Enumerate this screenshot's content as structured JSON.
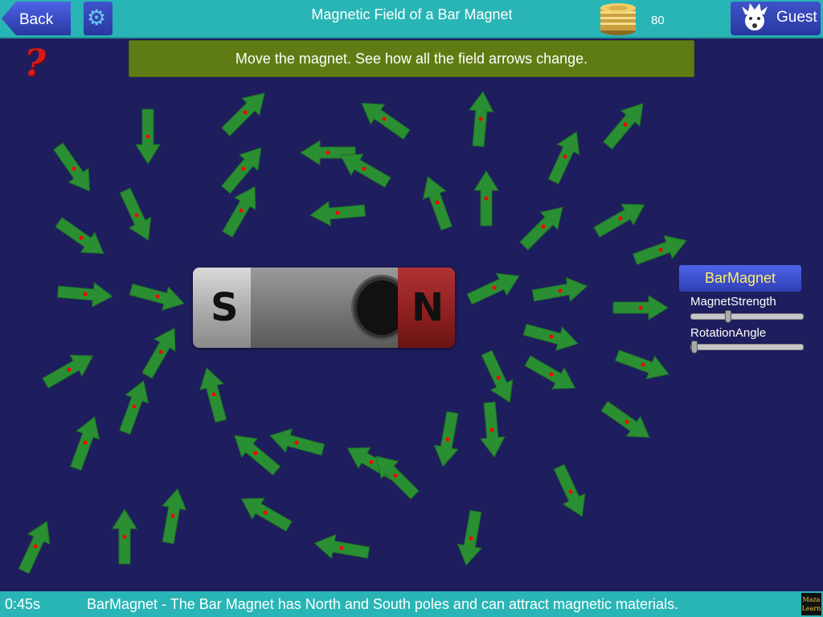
{
  "header": {
    "back_label": "Back",
    "title": "Magnetic Field of a Bar Magnet",
    "coin_count": "80",
    "user_label": "Guest",
    "settings_icon": "gear-icon",
    "coins_icon": "coin-stack-icon",
    "user_icon": "guest-avatar-icon"
  },
  "help": {
    "icon": "question-mark-icon",
    "glyph": "?"
  },
  "instruction": "Move the magnet. See how all the field arrows change.",
  "magnet": {
    "south_label": "S",
    "north_label": "N"
  },
  "panel": {
    "title": "BarMagnet",
    "sliders": [
      {
        "label": "MagnetStrength",
        "value": 0.32
      },
      {
        "label": "RotationAngle",
        "value": 0.0
      }
    ]
  },
  "footer": {
    "timer": "0:45s",
    "status": "BarMagnet - The Bar Magnet has North and South poles and can attract magnetic materials.",
    "logo_line1": "Maza",
    "logo_line2": "Learn"
  },
  "colors": {
    "bar": "#29b5b5",
    "background": "#1e1e5e",
    "arrow": "#2a8f33",
    "arrow_dot": "#ff0000",
    "instruction_bg": "#5f7c14",
    "panel_title": "#ffee66"
  }
}
